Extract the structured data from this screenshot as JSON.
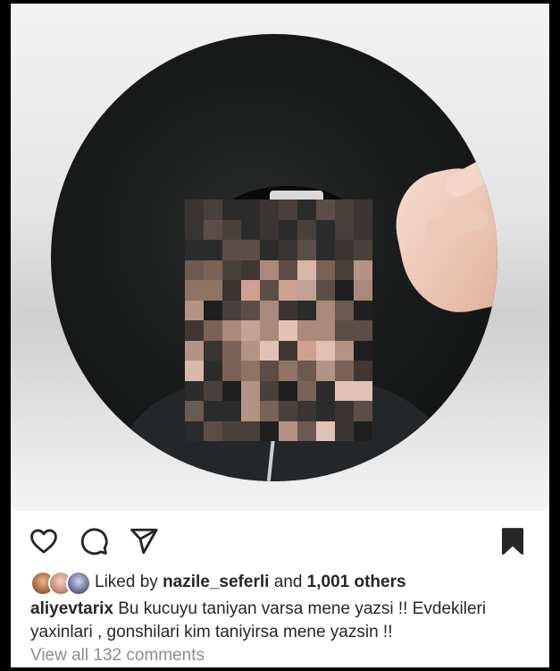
{
  "post": {
    "image_description_icon": "profile-photo-pixelated",
    "liked_by_prefix": "Liked by",
    "liked_by_user": "nazile_seferli",
    "liked_by_and": "and",
    "liked_by_others": "1,001 others",
    "caption_user": "aliyevtarix",
    "caption_text": "Bu kucuyu taniyan varsa mene yazsi !! Evdekileri yaxinlari , gonshilari kim taniyirsa mene yazsin !!",
    "view_comments": "View all 132 comments"
  },
  "actions": {
    "like": "heart-icon",
    "comment": "comment-icon",
    "share": "send-icon",
    "save": "bookmark-icon"
  },
  "colors": {
    "text": "#262626",
    "muted": "#8e8e8e",
    "frame_bg": "#000000"
  }
}
